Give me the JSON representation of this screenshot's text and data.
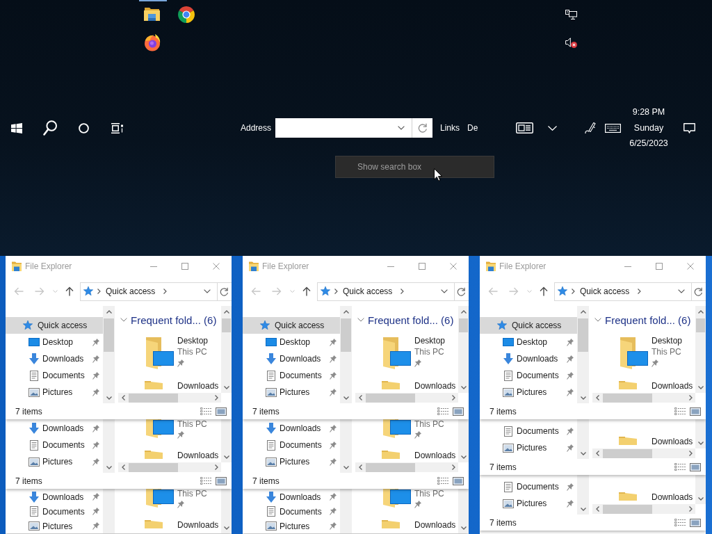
{
  "taskbar": {
    "pinned_apps": [
      {
        "kind": "folder",
        "active": true
      },
      {
        "kind": "chrome",
        "active": false
      },
      {
        "kind": "firefox",
        "active": false
      }
    ],
    "toolbars": [
      {
        "kind": "address",
        "label": "Address"
      },
      {
        "kind": "label",
        "label": "Links"
      },
      {
        "kind": "label",
        "label": "De"
      }
    ],
    "tray": {
      "volume_muted": true
    },
    "clock": {
      "time": "9:28 PM",
      "day": "Sunday",
      "date": "6/25/2023"
    },
    "tooltip": "Show search box"
  },
  "windows": [
    {
      "title": "File Explorer",
      "active": false,
      "nav_buttons": [
        {
          "kind": "back",
          "disabled": true
        },
        {
          "kind": "forward",
          "disabled": true
        },
        {
          "kind": "recent",
          "disabled": true
        },
        {
          "kind": "up",
          "disabled": false
        }
      ],
      "address": "Quick access",
      "nav_items": [
        {
          "kind": "quick_access",
          "label": "Quick access",
          "selected": true,
          "pinned": false
        },
        {
          "kind": "desktop",
          "label": "Desktop",
          "selected": false,
          "pinned": true
        },
        {
          "kind": "downloads",
          "label": "Downloads",
          "selected": false,
          "pinned": true
        },
        {
          "kind": "documents",
          "label": "Documents",
          "selected": false,
          "pinned": true
        },
        {
          "kind": "pictures",
          "label": "Pictures",
          "selected": false,
          "pinned": true
        }
      ],
      "group": {
        "title": "Frequent fold... (6)",
        "expanded": true
      },
      "tiles": [
        {
          "kind": "desktop",
          "name": "Desktop",
          "location": "This PC",
          "pinned": true
        },
        {
          "kind": "folder",
          "name": "Downloads",
          "pinned": false
        }
      ],
      "status": "7 items",
      "trails": [
        {
          "nav_items": [
            {
              "kind": "downloads",
              "label": "Downloads",
              "selected": false,
              "pinned": true
            },
            {
              "kind": "documents",
              "label": "Documents",
              "selected": false,
              "pinned": true
            },
            {
              "kind": "pictures",
              "label": "Pictures",
              "selected": false,
              "pinned": true
            }
          ],
          "tiles": [
            {
              "kind": "desktop",
              "location": "This PC",
              "pinned": true
            },
            {
              "kind": "folder",
              "name": "Downloads",
              "pinned": false
            }
          ],
          "status": "7 items"
        },
        {
          "nav_items": [
            {
              "kind": "downloads",
              "label": "Downloads",
              "selected": false,
              "pinned": true
            },
            {
              "kind": "documents",
              "label": "Documents",
              "selected": false,
              "pinned": true
            },
            {
              "kind": "pictures",
              "label": "Pictures",
              "selected": false,
              "pinned": true
            }
          ],
          "tiles": [
            {
              "kind": "desktop",
              "location": "This PC",
              "pinned": true
            },
            {
              "kind": "folder",
              "name": "Downloads",
              "pinned": false
            }
          ]
        }
      ]
    },
    {
      "title": "File Explorer",
      "active": false,
      "nav_buttons": [
        {
          "kind": "back",
          "disabled": true
        },
        {
          "kind": "forward",
          "disabled": true
        },
        {
          "kind": "recent",
          "disabled": true
        },
        {
          "kind": "up",
          "disabled": false
        }
      ],
      "address": "Quick access",
      "nav_items": [
        {
          "kind": "quick_access",
          "label": "Quick access",
          "selected": true,
          "pinned": false
        },
        {
          "kind": "desktop",
          "label": "Desktop",
          "selected": false,
          "pinned": true
        },
        {
          "kind": "downloads",
          "label": "Downloads",
          "selected": false,
          "pinned": true
        },
        {
          "kind": "documents",
          "label": "Documents",
          "selected": false,
          "pinned": true
        },
        {
          "kind": "pictures",
          "label": "Pictures",
          "selected": false,
          "pinned": true
        }
      ],
      "group": {
        "title": "Frequent fold... (6)",
        "expanded": true
      },
      "tiles": [
        {
          "kind": "desktop",
          "name": "Desktop",
          "location": "This PC",
          "pinned": true
        },
        {
          "kind": "folder",
          "name": "Downloads",
          "pinned": false
        }
      ],
      "status": "7 items",
      "trails": [
        {
          "nav_items": [
            {
              "kind": "downloads",
              "label": "Downloads",
              "selected": false,
              "pinned": true
            },
            {
              "kind": "documents",
              "label": "Documents",
              "selected": false,
              "pinned": true
            },
            {
              "kind": "pictures",
              "label": "Pictures",
              "selected": false,
              "pinned": true
            }
          ],
          "tiles": [
            {
              "kind": "desktop",
              "location": "This PC",
              "pinned": true
            },
            {
              "kind": "folder",
              "name": "Downloads",
              "pinned": false
            }
          ],
          "status": "7 items"
        },
        {
          "nav_items": [
            {
              "kind": "downloads",
              "label": "Downloads",
              "selected": false,
              "pinned": true
            },
            {
              "kind": "documents",
              "label": "Documents",
              "selected": false,
              "pinned": true
            },
            {
              "kind": "pictures",
              "label": "Pictures",
              "selected": false,
              "pinned": true
            }
          ],
          "tiles": [
            {
              "kind": "desktop",
              "location": "This PC",
              "pinned": true
            },
            {
              "kind": "folder",
              "name": "Downloads",
              "pinned": false
            }
          ]
        }
      ]
    },
    {
      "title": "File Explorer",
      "active": false,
      "nav_buttons": [
        {
          "kind": "back",
          "disabled": true
        },
        {
          "kind": "forward",
          "disabled": true
        },
        {
          "kind": "recent",
          "disabled": true
        },
        {
          "kind": "up",
          "disabled": false
        }
      ],
      "address": "Quick access",
      "nav_items": [
        {
          "kind": "quick_access",
          "label": "Quick access",
          "selected": true,
          "pinned": false
        },
        {
          "kind": "desktop",
          "label": "Desktop",
          "selected": false,
          "pinned": true
        },
        {
          "kind": "downloads",
          "label": "Downloads",
          "selected": false,
          "pinned": true
        },
        {
          "kind": "documents",
          "label": "Documents",
          "selected": false,
          "pinned": true
        },
        {
          "kind": "pictures",
          "label": "Pictures",
          "selected": false,
          "pinned": true
        }
      ],
      "group": {
        "title": "Frequent fold... (6)",
        "expanded": true
      },
      "tiles": [
        {
          "kind": "desktop",
          "name": "Desktop",
          "location": "This PC",
          "pinned": true
        },
        {
          "kind": "folder",
          "name": "Downloads",
          "pinned": false
        }
      ],
      "status": "7 items",
      "trails": [
        {
          "nav_items": [
            {
              "kind": "documents",
              "label": "Documents",
              "selected": false,
              "pinned": true
            },
            {
              "kind": "pictures",
              "label": "Pictures",
              "selected": false,
              "pinned": true
            }
          ],
          "tiles": [
            {
              "kind": "folder",
              "name": "Downloads",
              "pinned": false
            }
          ],
          "status": "7 items"
        },
        {
          "nav_items": [
            {
              "kind": "documents",
              "label": "Documents",
              "selected": false,
              "pinned": true
            },
            {
              "kind": "pictures",
              "label": "Pictures",
              "selected": false,
              "pinned": true
            }
          ],
          "tiles": [
            {
              "kind": "folder",
              "name": "Downloads",
              "pinned": false
            }
          ],
          "status": "7 items"
        }
      ]
    }
  ]
}
